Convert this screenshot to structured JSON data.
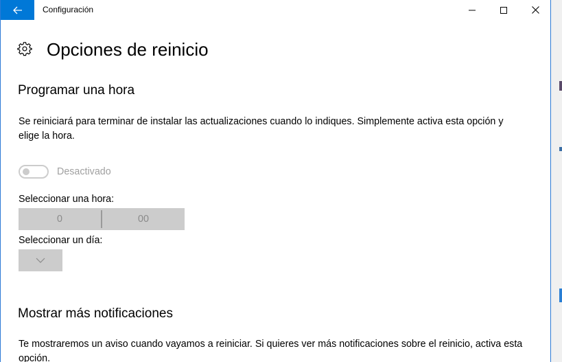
{
  "window": {
    "title": "Configuración",
    "back_icon": "arrow-left-icon",
    "minimize_icon": "minimize-icon",
    "maximize_icon": "maximize-icon",
    "close_icon": "close-icon",
    "accent_color": "#0078d7"
  },
  "header": {
    "icon": "gear-icon",
    "title": "Opciones de reinicio"
  },
  "schedule": {
    "title": "Programar una hora",
    "description": "Se reiniciará para terminar de instalar las actualizaciones cuando lo indiques. Simplemente activa esta opción y elige la hora.",
    "toggle_state": "off",
    "toggle_label": "Desactivado",
    "time_label": "Seleccionar una hora:",
    "hour_value": "0",
    "minute_value": "00",
    "day_label": "Seleccionar un día:",
    "day_dropdown_icon": "chevron-down-icon"
  },
  "notifications": {
    "title": "Mostrar más notificaciones",
    "description": "Te mostraremos un aviso cuando vayamos a reiniciar. Si quieres ver más notificaciones sobre el reinicio, activa esta opción."
  }
}
